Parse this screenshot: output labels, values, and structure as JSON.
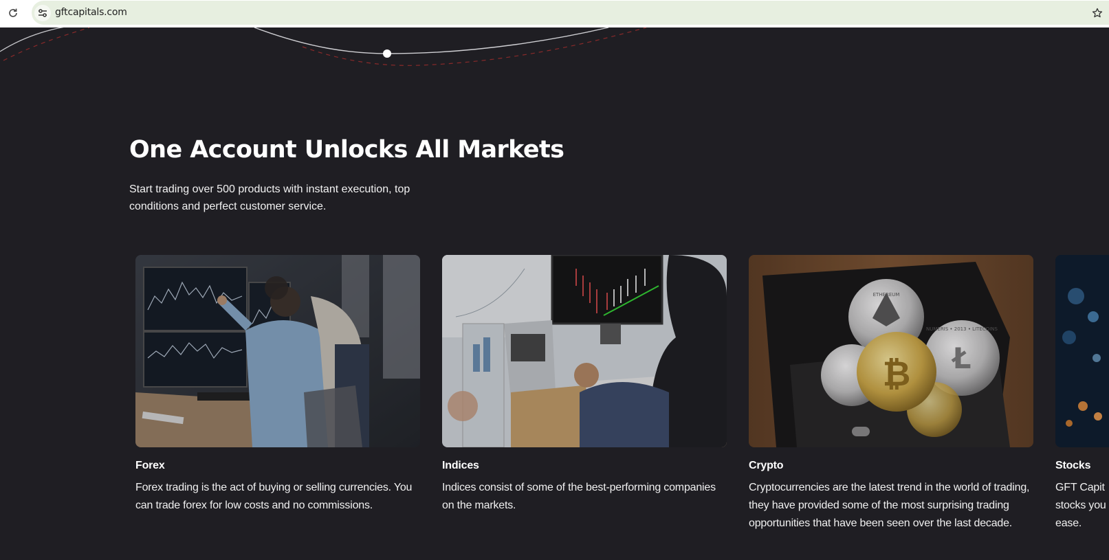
{
  "browser": {
    "url": "gftcapitals.com"
  },
  "hero": {
    "title": "One Account Unlocks All Markets",
    "subtitle": "Start trading over 500 products with instant execution, top conditions and perfect customer service."
  },
  "markets": [
    {
      "title": "Forex",
      "description": "Forex trading is the act of buying or selling currencies. You can trade forex for low costs and no commissions."
    },
    {
      "title": "Indices",
      "description": "Indices consist of some of the best-performing companies on the markets."
    },
    {
      "title": "Crypto",
      "description": "Cryptocurrencies are the latest trend in the world of trading, they have provided some of the most surprising trading opportunities that have been seen over the last decade."
    },
    {
      "title": "Stocks",
      "description": "GFT Capit stocks you ease."
    }
  ],
  "crypto_coin_text": {
    "eth": "ETHEREUM",
    "ltc": "NUMERIS • 2013 • LITECOINS"
  },
  "colors": {
    "page_background": "#1f1e23",
    "omnibox": "#e7efe0",
    "accent_dashed": "#8a2a2a"
  }
}
